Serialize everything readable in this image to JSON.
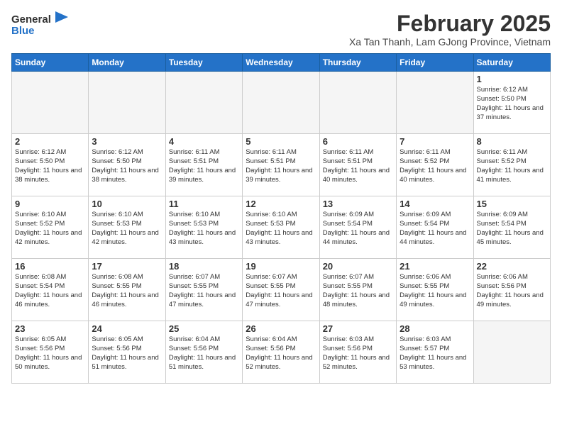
{
  "header": {
    "logo_general": "General",
    "logo_blue": "Blue",
    "month_title": "February 2025",
    "subtitle": "Xa Tan Thanh, Lam GJong Province, Vietnam"
  },
  "weekdays": [
    "Sunday",
    "Monday",
    "Tuesday",
    "Wednesday",
    "Thursday",
    "Friday",
    "Saturday"
  ],
  "weeks": [
    [
      {
        "day": "",
        "info": ""
      },
      {
        "day": "",
        "info": ""
      },
      {
        "day": "",
        "info": ""
      },
      {
        "day": "",
        "info": ""
      },
      {
        "day": "",
        "info": ""
      },
      {
        "day": "",
        "info": ""
      },
      {
        "day": "1",
        "info": "Sunrise: 6:12 AM\nSunset: 5:50 PM\nDaylight: 11 hours\nand 37 minutes."
      }
    ],
    [
      {
        "day": "2",
        "info": "Sunrise: 6:12 AM\nSunset: 5:50 PM\nDaylight: 11 hours\nand 38 minutes."
      },
      {
        "day": "3",
        "info": "Sunrise: 6:12 AM\nSunset: 5:50 PM\nDaylight: 11 hours\nand 38 minutes."
      },
      {
        "day": "4",
        "info": "Sunrise: 6:11 AM\nSunset: 5:51 PM\nDaylight: 11 hours\nand 39 minutes."
      },
      {
        "day": "5",
        "info": "Sunrise: 6:11 AM\nSunset: 5:51 PM\nDaylight: 11 hours\nand 39 minutes."
      },
      {
        "day": "6",
        "info": "Sunrise: 6:11 AM\nSunset: 5:51 PM\nDaylight: 11 hours\nand 40 minutes."
      },
      {
        "day": "7",
        "info": "Sunrise: 6:11 AM\nSunset: 5:52 PM\nDaylight: 11 hours\nand 40 minutes."
      },
      {
        "day": "8",
        "info": "Sunrise: 6:11 AM\nSunset: 5:52 PM\nDaylight: 11 hours\nand 41 minutes."
      }
    ],
    [
      {
        "day": "9",
        "info": "Sunrise: 6:10 AM\nSunset: 5:52 PM\nDaylight: 11 hours\nand 42 minutes."
      },
      {
        "day": "10",
        "info": "Sunrise: 6:10 AM\nSunset: 5:53 PM\nDaylight: 11 hours\nand 42 minutes."
      },
      {
        "day": "11",
        "info": "Sunrise: 6:10 AM\nSunset: 5:53 PM\nDaylight: 11 hours\nand 43 minutes."
      },
      {
        "day": "12",
        "info": "Sunrise: 6:10 AM\nSunset: 5:53 PM\nDaylight: 11 hours\nand 43 minutes."
      },
      {
        "day": "13",
        "info": "Sunrise: 6:09 AM\nSunset: 5:54 PM\nDaylight: 11 hours\nand 44 minutes."
      },
      {
        "day": "14",
        "info": "Sunrise: 6:09 AM\nSunset: 5:54 PM\nDaylight: 11 hours\nand 44 minutes."
      },
      {
        "day": "15",
        "info": "Sunrise: 6:09 AM\nSunset: 5:54 PM\nDaylight: 11 hours\nand 45 minutes."
      }
    ],
    [
      {
        "day": "16",
        "info": "Sunrise: 6:08 AM\nSunset: 5:54 PM\nDaylight: 11 hours\nand 46 minutes."
      },
      {
        "day": "17",
        "info": "Sunrise: 6:08 AM\nSunset: 5:55 PM\nDaylight: 11 hours\nand 46 minutes."
      },
      {
        "day": "18",
        "info": "Sunrise: 6:07 AM\nSunset: 5:55 PM\nDaylight: 11 hours\nand 47 minutes."
      },
      {
        "day": "19",
        "info": "Sunrise: 6:07 AM\nSunset: 5:55 PM\nDaylight: 11 hours\nand 47 minutes."
      },
      {
        "day": "20",
        "info": "Sunrise: 6:07 AM\nSunset: 5:55 PM\nDaylight: 11 hours\nand 48 minutes."
      },
      {
        "day": "21",
        "info": "Sunrise: 6:06 AM\nSunset: 5:55 PM\nDaylight: 11 hours\nand 49 minutes."
      },
      {
        "day": "22",
        "info": "Sunrise: 6:06 AM\nSunset: 5:56 PM\nDaylight: 11 hours\nand 49 minutes."
      }
    ],
    [
      {
        "day": "23",
        "info": "Sunrise: 6:05 AM\nSunset: 5:56 PM\nDaylight: 11 hours\nand 50 minutes."
      },
      {
        "day": "24",
        "info": "Sunrise: 6:05 AM\nSunset: 5:56 PM\nDaylight: 11 hours\nand 51 minutes."
      },
      {
        "day": "25",
        "info": "Sunrise: 6:04 AM\nSunset: 5:56 PM\nDaylight: 11 hours\nand 51 minutes."
      },
      {
        "day": "26",
        "info": "Sunrise: 6:04 AM\nSunset: 5:56 PM\nDaylight: 11 hours\nand 52 minutes."
      },
      {
        "day": "27",
        "info": "Sunrise: 6:03 AM\nSunset: 5:56 PM\nDaylight: 11 hours\nand 52 minutes."
      },
      {
        "day": "28",
        "info": "Sunrise: 6:03 AM\nSunset: 5:57 PM\nDaylight: 11 hours\nand 53 minutes."
      },
      {
        "day": "",
        "info": ""
      }
    ]
  ]
}
